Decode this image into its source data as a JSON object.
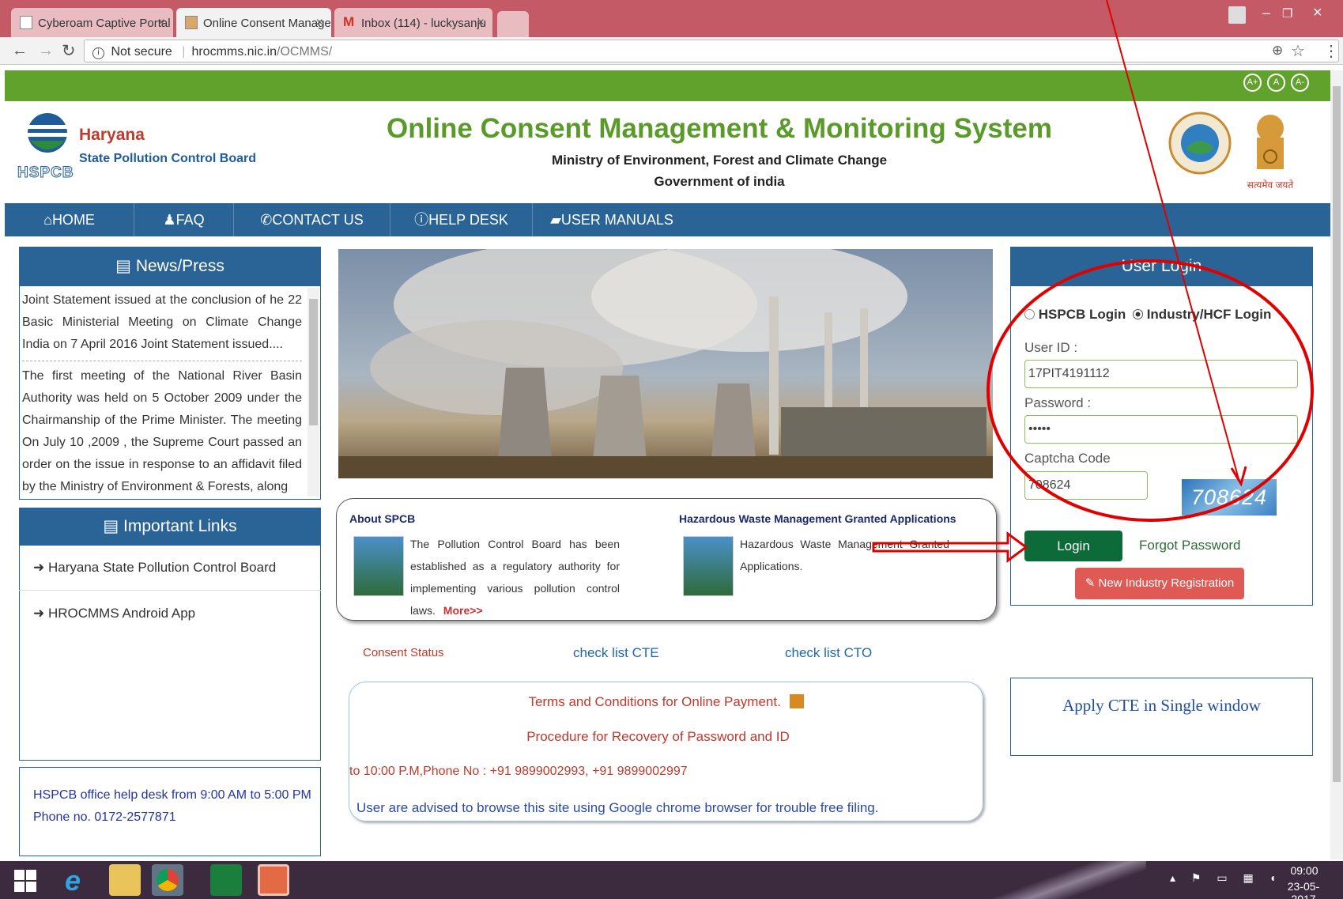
{
  "browser": {
    "tabs": [
      {
        "label": "Cyberoam Captive Portal",
        "close": "×"
      },
      {
        "label": "Online Consent Manage",
        "close": "×"
      },
      {
        "label": "Inbox (114) - luckysanju",
        "close": "×"
      }
    ],
    "security": "Not secure",
    "url_host": "hrocmms.nic.in",
    "url_path": "/OCMMS/",
    "window_controls": {
      "minimize": "–",
      "restore": "❐",
      "close": "×"
    }
  },
  "font_size": {
    "increase": "A+",
    "normal": "A",
    "decrease": "A-"
  },
  "header": {
    "org_name": "Haryana",
    "org_sub": "State Pollution Control Board",
    "logo_text": "HSPCB",
    "title": "Online Consent Management & Monitoring System",
    "ministry": "Ministry of Environment, Forest and Climate Change",
    "government": "Government of india",
    "emblem_text": "सत्यमेव जयते"
  },
  "nav": [
    {
      "label": "HOME",
      "icon": "home-icon"
    },
    {
      "label": "FAQ",
      "icon": "user-icon"
    },
    {
      "label": "CONTACT US",
      "icon": "phone-icon"
    },
    {
      "label": "HELP DESK",
      "icon": "info-icon"
    },
    {
      "label": "USER MANUALS",
      "icon": "book-icon"
    }
  ],
  "news": {
    "title": "News/Press",
    "items": [
      "Joint Statement issued at the conclusion of he 22 Basic Ministerial Meeting on Climate Change India on 7 April 2016 Joint Statement issued....",
      "The first meeting of the National River Basin Authority was held on 5 October 2009 under the Chairmanship of the Prime Minister. The meeting On July 10 ,2009 , the Supreme Court passed an order on the issue in response to an affidavit filed by the Ministry of Environment & Forests, along"
    ]
  },
  "links": {
    "title": "Important Links",
    "items": [
      "Haryana State Pollution Control Board",
      "HROCMMS Android App"
    ]
  },
  "helpdesk": {
    "line1": "HSPCB office help desk from 9:00 AM to 5:00 PM",
    "line2": "Phone no. 0172-2577871"
  },
  "about": {
    "title": "About SPCB",
    "text": "The Pollution Control Board has been established as a regulatory authority for implementing various pollution control laws.",
    "more": "More>>"
  },
  "hazard": {
    "title": "Hazardous Waste Management Granted Applications",
    "text": "Hazardous Waste Management Granted Applications."
  },
  "status_links": [
    "Consent Status",
    "check list CTE",
    "check list CTO"
  ],
  "marquee": {
    "terms": "Terms and Conditions for Online Payment.",
    "recovery": "Procedure for Recovery of Password and ID",
    "phone": "to 10:00 P.M,Phone No : +91 9899002993, +91 9899002997",
    "advice": "User are advised to browse this site using Google chrome browser for trouble free filing."
  },
  "login": {
    "title": "User Login",
    "option_hspcb": "HSPCB Login",
    "option_industry": "Industry/HCF Login",
    "user_label": "User ID :",
    "user_value": "17PIT4191112",
    "password_label": "Password :",
    "password_value": "•••••",
    "captcha_label": "Captcha Code",
    "captcha_value": "708624",
    "captcha_image": "708624",
    "login_button": "Login",
    "forgot": "Forgot Password",
    "register": "New Industry Registration"
  },
  "apply_cte": "Apply CTE in Single window",
  "taskbar": {
    "time": "09:00",
    "date": "23-05-2017"
  },
  "colors": {
    "nav": "#2a6496",
    "green": "#61a22c",
    "title": "#5a9a2a",
    "annotation": "#e00000"
  }
}
